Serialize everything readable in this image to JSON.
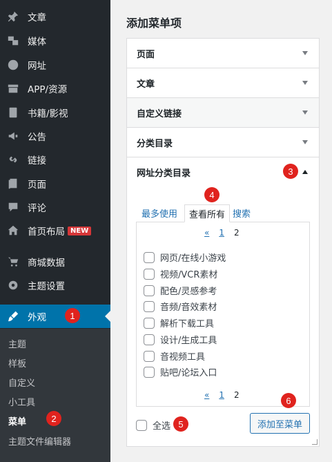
{
  "sidebar": {
    "items": [
      {
        "label": "文章",
        "icon": "pin-icon"
      },
      {
        "label": "媒体",
        "icon": "media-icon"
      },
      {
        "label": "网址",
        "icon": "globe-icon"
      },
      {
        "label": "APP/资源",
        "icon": "archive-icon"
      },
      {
        "label": "书籍/影视",
        "icon": "book-icon"
      },
      {
        "label": "公告",
        "icon": "megaphone-icon"
      },
      {
        "label": "链接",
        "icon": "link-icon"
      },
      {
        "label": "页面",
        "icon": "page-icon"
      },
      {
        "label": "评论",
        "icon": "comment-icon"
      },
      {
        "label": "首页布局",
        "icon": "home-icon",
        "badge": "NEW"
      },
      {
        "label": "商城数据",
        "icon": "cart-icon"
      },
      {
        "label": "主题设置",
        "icon": "gear-icon"
      },
      {
        "label": "外观",
        "icon": "brush-icon",
        "active": true
      }
    ],
    "submenu": [
      {
        "label": "主题"
      },
      {
        "label": "样板"
      },
      {
        "label": "自定义"
      },
      {
        "label": "小工具"
      },
      {
        "label": "菜单",
        "current": true
      },
      {
        "label": "主题文件编辑器"
      }
    ]
  },
  "main": {
    "title": "添加菜单项",
    "panels": [
      {
        "label": "页面"
      },
      {
        "label": "文章"
      },
      {
        "label": "自定义链接"
      },
      {
        "label": "分类目录"
      },
      {
        "label": "网址分类目录"
      }
    ],
    "tabs": [
      "最多使用",
      "查看所有",
      "搜索"
    ],
    "pager": {
      "prev": "«",
      "page1": "1",
      "page2": "2"
    },
    "checkboxes": [
      "网页/在线小游戏",
      "视频/VCR素材",
      "配色/灵感参考",
      "音频/音效素材",
      "解析下载工具",
      "设计/生成工具",
      "音视频工具",
      "贴吧/论坛入口"
    ],
    "select_all": "全选",
    "add_button": "添加至菜单"
  },
  "markers": [
    "1",
    "2",
    "3",
    "4",
    "5",
    "6"
  ],
  "colors": {
    "sidebar_bg": "#23282d",
    "active_bg": "#0073aa",
    "link": "#2271b1",
    "marker": "#e0231e"
  }
}
